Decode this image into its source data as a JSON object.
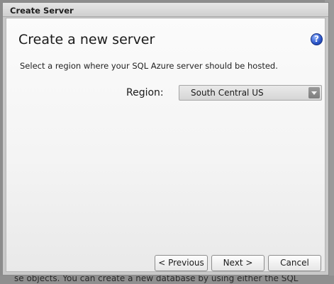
{
  "background": {
    "footer_text": "se objects.  You can create a new database by using either the SQL"
  },
  "dialog": {
    "title": "Create Server",
    "heading": "Create a new server",
    "help_icon": "?",
    "description": "Select a region where your SQL Azure server should be hosted.",
    "region": {
      "label": "Region:",
      "selected": "South Central US"
    },
    "buttons": {
      "previous": "< Previous",
      "next": "Next >",
      "cancel": "Cancel"
    }
  },
  "colors": {
    "accent_help": "#2b55c7",
    "dialog_frame": "#c9c9c9"
  }
}
